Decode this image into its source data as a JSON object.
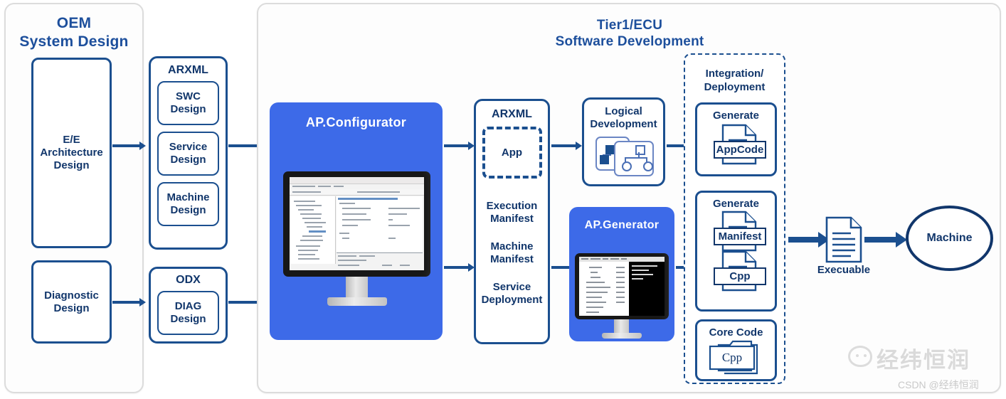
{
  "oem": {
    "title_line1": "OEM",
    "title_line2": "System  Design",
    "ee_box": "E/E\nArchitecture\nDesign",
    "ee_label": "E/E Architecture Design",
    "diag_box": "Diagnostic\nDesign",
    "diag_label": "Diagnostic Design"
  },
  "exchange": {
    "arxml_title": "ARXML",
    "arxml_items": [
      "SWC\nDesign",
      "Service\nDesign",
      "Machine\nDesign"
    ],
    "arxml_item_swc": "SWC Design",
    "arxml_item_service": "Service Design",
    "arxml_item_machine": "Machine Design",
    "odx_title": "ODX",
    "odx_item": "DIAG\nDesign",
    "odx_item_label": "DIAG Design"
  },
  "tier1": {
    "title_line1": "Tier1/ECU",
    "title_line2": "Software Development"
  },
  "configurator": {
    "title": "AP.Configurator"
  },
  "arxml_output": {
    "title": "ARXML",
    "app_label": "App",
    "items": [
      "Execution\nManifest",
      "Machine\nManifest",
      "Service\nDeployment"
    ],
    "item_execution": "Execution Manifest",
    "item_machine": "Machine Manifest",
    "item_service": "Service Deployment"
  },
  "logical_development": {
    "title": "Logical\nDevelopment",
    "title_line1": "Logical",
    "title_line2": "Development"
  },
  "generator": {
    "title": "AP.Generator"
  },
  "integration": {
    "title_line1": "Integration/",
    "title_line2": "Deployment",
    "cards": [
      {
        "heading": "Generate",
        "tag": "AppCode",
        "name": "generate-appcode-card"
      },
      {
        "heading": "Generate",
        "tag": "Manifest",
        "tag2": "Cpp",
        "name": "generate-manifest-cpp-card"
      },
      {
        "heading": "Core Code",
        "tag": "Cpp",
        "name": "core-code-card"
      }
    ]
  },
  "output": {
    "executable_label": "Execuable",
    "machine_label": "Machine"
  },
  "watermark": {
    "brand": "经纬恒润",
    "credit": "CSDN @经纬恒润"
  },
  "colors": {
    "navy": "#11366b",
    "navy_border": "#1b4f8f",
    "brand_blue": "#3d6ae8",
    "heading_blue": "#1d4f9c",
    "panel_border": "#dcdcdc"
  }
}
